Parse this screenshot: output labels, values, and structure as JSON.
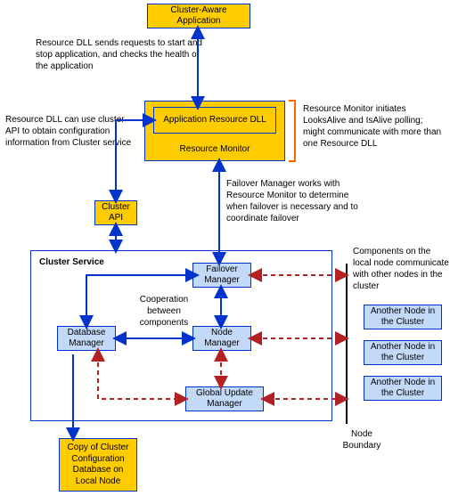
{
  "nodes": {
    "app": "Cluster-Aware Application",
    "appres": "Application Resource DLL",
    "resmon": "Resource Monitor",
    "api": "Cluster API",
    "failover": "Failover Manager",
    "nodemgr": "Node Manager",
    "dbmgr": "Database Manager",
    "gum": "Global Update Manager",
    "copydb": "Copy of Cluster Configuration Database on Local Node",
    "another1": "Another Node in the Cluster",
    "another2": "Another Node in the Cluster",
    "another3": "Another Node in the Cluster"
  },
  "labels": {
    "clustersvc": "Cluster Service",
    "nodeboundary": "Node Boundary"
  },
  "annotations": {
    "a1": "Resource DLL sends requests to start and stop application, and checks the health of the application",
    "a2": "Resource Monitor initiates LooksAlive and IsAlive polling; might communicate with more than one Resource DLL",
    "a3": "Resource DLL can use cluster API to obtain configuration information from Cluster service",
    "a4": "Failover Manager works with Resource Monitor to determine when failover is necessary and to coordinate failover",
    "a5": "Components on the local node communicate with other nodes in the cluster",
    "a6": "Cooperation between components"
  }
}
